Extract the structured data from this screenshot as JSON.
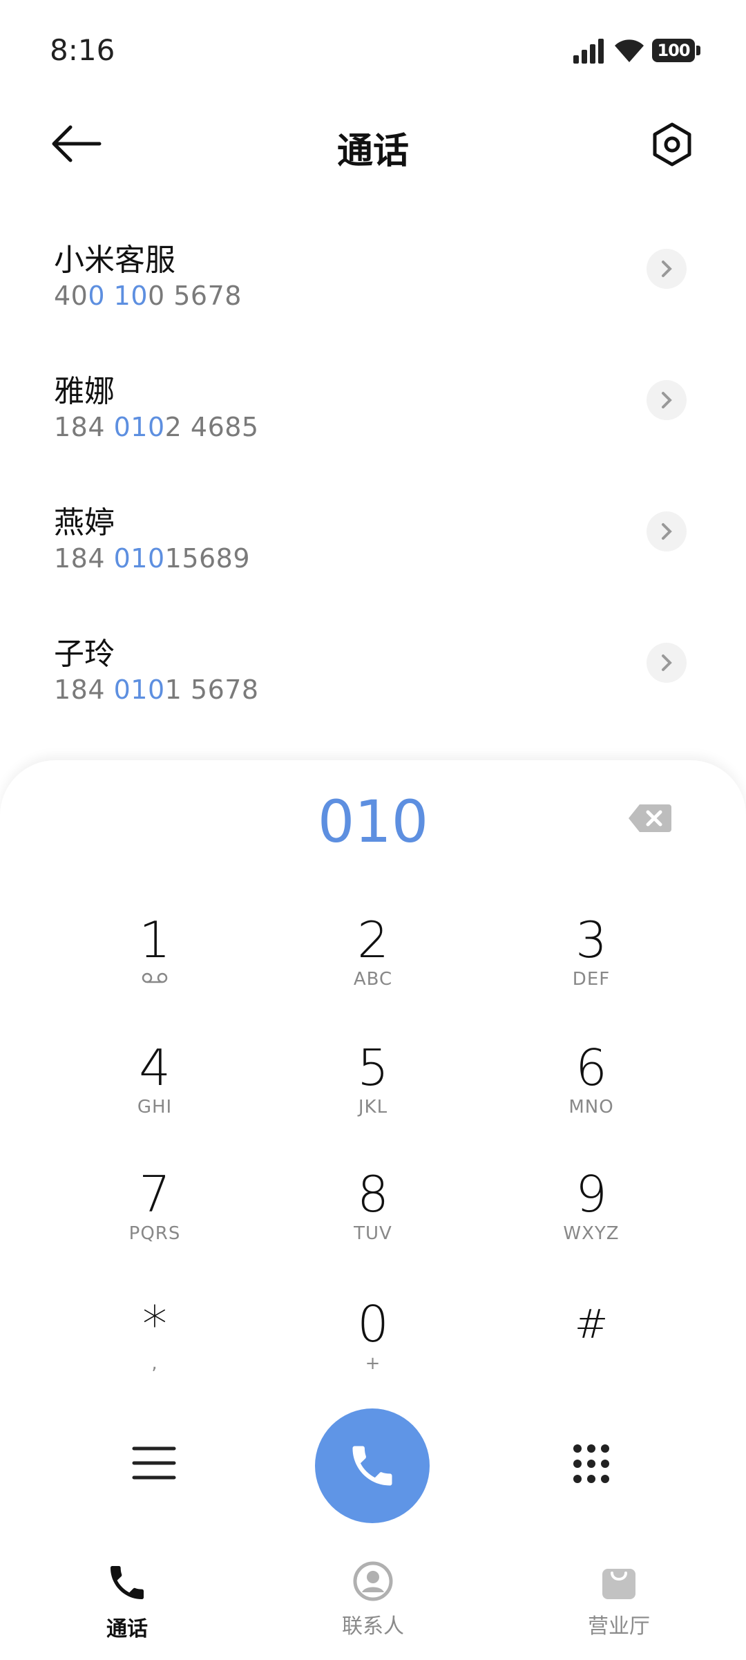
{
  "status_bar": {
    "time": "8:16",
    "battery": "100"
  },
  "header": {
    "title": "通话"
  },
  "contacts": [
    {
      "name": "小米客服",
      "num_pre": "40",
      "num_hl1": "0",
      "num_mid": " ",
      "num_hl2": "10",
      "num_post": "0 5678"
    },
    {
      "name": "雅娜",
      "num_pre": "184 ",
      "num_hl1": "010",
      "num_mid": "",
      "num_hl2": "",
      "num_post": "2 4685"
    },
    {
      "name": "燕婷",
      "num_pre": "184 ",
      "num_hl1": "010",
      "num_mid": "",
      "num_hl2": "",
      "num_post": "15689"
    },
    {
      "name": "子玲",
      "num_pre": "184 ",
      "num_hl1": "010",
      "num_mid": "",
      "num_hl2": "",
      "num_post": "1 5678"
    }
  ],
  "dialer": {
    "input": "010",
    "keys": [
      {
        "digit": "1",
        "letters": ""
      },
      {
        "digit": "2",
        "letters": "ABC"
      },
      {
        "digit": "3",
        "letters": "DEF"
      },
      {
        "digit": "4",
        "letters": "GHI"
      },
      {
        "digit": "5",
        "letters": "JKL"
      },
      {
        "digit": "6",
        "letters": "MNO"
      },
      {
        "digit": "7",
        "letters": "PQRS"
      },
      {
        "digit": "8",
        "letters": "TUV"
      },
      {
        "digit": "9",
        "letters": "WXYZ"
      },
      {
        "digit": "*",
        "letters": ","
      },
      {
        "digit": "0",
        "letters": "+"
      },
      {
        "digit": "#",
        "letters": ""
      }
    ]
  },
  "nav": {
    "tabs": [
      {
        "label": "通话",
        "icon": "phone-icon",
        "active": true
      },
      {
        "label": "联系人",
        "icon": "contacts-icon",
        "active": false
      },
      {
        "label": "营业厅",
        "icon": "shop-icon",
        "active": false
      }
    ]
  },
  "colors": {
    "accent": "#5d8fe0",
    "call_button": "#5f95e6"
  }
}
